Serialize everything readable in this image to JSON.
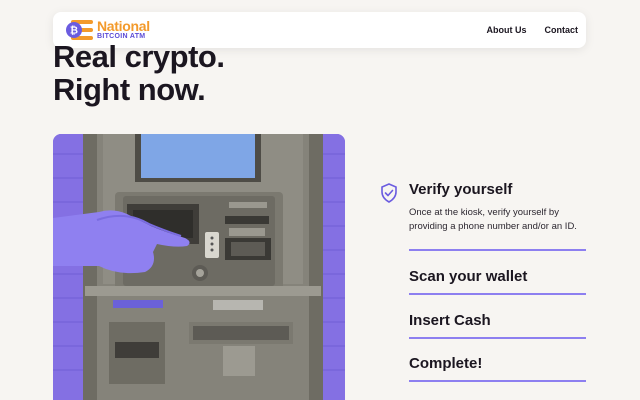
{
  "header": {
    "logo_top": "National",
    "logo_bottom": "BITCOIN ATM",
    "nav": [
      {
        "label": "About Us"
      },
      {
        "label": "Contact"
      }
    ]
  },
  "hero": {
    "line1": "Real crypto.",
    "line2": "Right now."
  },
  "steps": [
    {
      "title": "Verify yourself",
      "description": "Once at the kiosk, verify yourself by providing a phone number and/or an ID.",
      "active": true
    },
    {
      "title": "Scan your wallet"
    },
    {
      "title": "Insert Cash"
    },
    {
      "title": "Complete!"
    }
  ],
  "colors": {
    "brand_orange": "#f39a2b",
    "brand_purple": "#5b4bd6",
    "accent_line": "#8d7ff0",
    "background": "#f7f5f2"
  },
  "image": {
    "subject": "bitcoin-atm-photo"
  }
}
